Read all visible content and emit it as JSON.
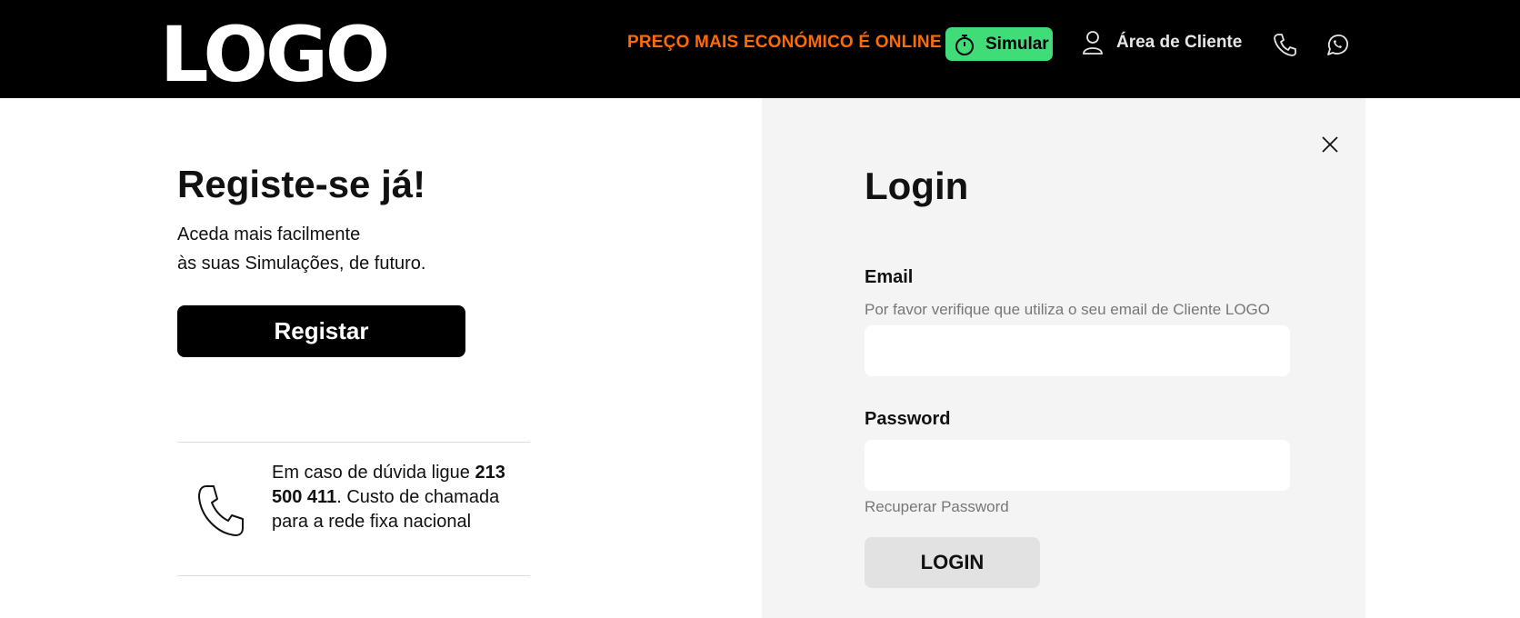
{
  "header": {
    "logo_text": "LOGO",
    "promo_text": "PREÇO MAIS ECONÓMICO É ONLINE",
    "simular_label": "Simular",
    "area_cliente_label": "Área de Cliente",
    "icons": [
      "stopwatch-icon",
      "user-icon",
      "phone-icon",
      "whatsapp-icon"
    ],
    "colors": {
      "background": "#000000",
      "promo": "#ff6b00",
      "simular_bg": "#3fdc77"
    }
  },
  "register": {
    "title": "Registe-se já!",
    "subtitle_line1": "Aceda mais facilmente",
    "subtitle_line2": "às suas Simulações, de futuro.",
    "button_label": "Registar"
  },
  "help": {
    "text_before": "Em caso de dúvida ligue ",
    "phone_number": "213 500 411",
    "text_after": ". Custo de chamada para a rede fixa nacional",
    "icon": "phone-icon"
  },
  "login": {
    "title": "Login",
    "email_label": "Email",
    "email_hint": "Por favor verifique que utiliza o seu email de Cliente LOGO",
    "email_value": "",
    "password_label": "Password",
    "password_value": "",
    "recover_label": "Recuperar Password",
    "button_label": "LOGIN",
    "close_icon": "close-icon",
    "colors": {
      "panel_bg": "#f4f4f4",
      "button_bg": "#e2e2e2"
    }
  }
}
